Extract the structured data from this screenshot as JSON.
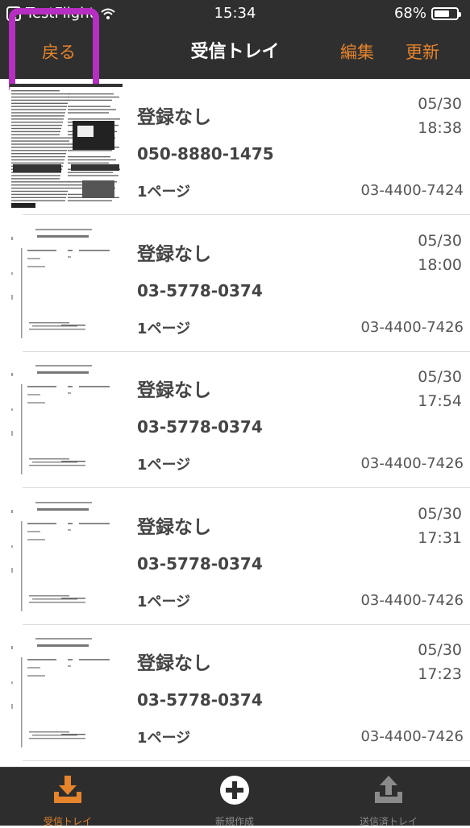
{
  "status_bar": {
    "carrier": "TestFlight",
    "time": "15:34",
    "battery": "68%",
    "battery_level": 0.68
  },
  "nav": {
    "back": "戻る",
    "title": "受信トレイ",
    "edit": "編集",
    "refresh": "更新"
  },
  "faxes": [
    {
      "sender": "登録なし",
      "number": "050-8880-1475",
      "pages": "1ページ",
      "date": "05/30",
      "time": "18:38",
      "received_on": "03-4400-7424",
      "thumbnail": "dense-document"
    },
    {
      "sender": "登録なし",
      "number": "03-5778-0374",
      "pages": "1ページ",
      "date": "05/30",
      "time": "18:00",
      "received_on": "03-4400-7426",
      "thumbnail": "fax-cover"
    },
    {
      "sender": "登録なし",
      "number": "03-5778-0374",
      "pages": "1ページ",
      "date": "05/30",
      "time": "17:54",
      "received_on": "03-4400-7426",
      "thumbnail": "fax-cover"
    },
    {
      "sender": "登録なし",
      "number": "03-5778-0374",
      "pages": "1ページ",
      "date": "05/30",
      "time": "17:31",
      "received_on": "03-4400-7426",
      "thumbnail": "fax-cover"
    },
    {
      "sender": "登録なし",
      "number": "03-5778-0374",
      "pages": "1ページ",
      "date": "05/30",
      "time": "17:23",
      "received_on": "03-4400-7426",
      "thumbnail": "fax-cover"
    }
  ],
  "tabs": [
    {
      "label": "受信トレイ",
      "icon": "inbox-download-icon",
      "active": true
    },
    {
      "label": "新規作成",
      "icon": "plus-circle-icon",
      "active": false
    },
    {
      "label": "送信済トレイ",
      "icon": "outbox-upload-icon",
      "active": false
    }
  ],
  "colors": {
    "accent": "#e6842c",
    "bar": "#2f2f2f",
    "highlight": "#b62fc2",
    "inactive_tab": "#8a8a8a"
  }
}
